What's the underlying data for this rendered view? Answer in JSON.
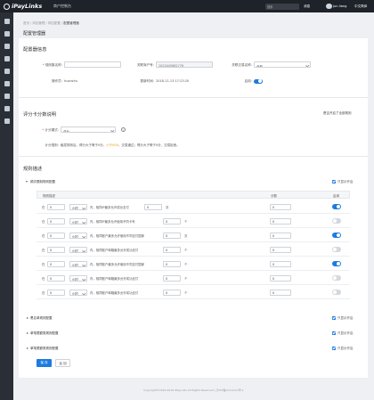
{
  "topbar": {
    "brand": "iPayLinks",
    "system_name": "商户控制台",
    "search_placeholder": "搜索",
    "notices": "消息",
    "user": "jun.liang",
    "help": "帮助",
    "lang": "中文简体"
  },
  "sidebar": {
    "icons": [
      "home-icon",
      "cart-icon",
      "list-icon",
      "card-icon",
      "document-icon",
      "user-icon",
      "shop-icon",
      "gear-icon",
      "shield-icon",
      "question-icon"
    ]
  },
  "breadcrumb": [
    "首页",
    "风控管理",
    "风控配置",
    "配置管理器"
  ],
  "page_title": "配置管理器",
  "config_info": {
    "title": "配置器信息",
    "rule_name_label": "规则集名称:",
    "rule_name_value": "",
    "merchant_no_label": "关联商户号:",
    "merchant_no_value": "1023445682776",
    "action_label": "关联交易名称:",
    "action_value": "全部",
    "operator_label": "操作员:",
    "operator_value": "huanzhu",
    "update_time_label": "更新时间:",
    "update_time_value": "2018-11-13 17:23:20",
    "enabled_label": "启用:",
    "enabled": true
  },
  "score_card": {
    "title": "评分卡分数说明",
    "link": "是否开启了全部规则",
    "calc_label": "计分模式:",
    "calc_value": "总分",
    "desc_label": "计分规则:",
    "desc_parts": [
      "触发规则后，得分大于等于0分，",
      "小于600",
      "，交易通过；得分大于等于0分，",
      "交易拒绝。"
    ]
  },
  "rules": {
    "title": "规则描述",
    "section1": {
      "label": "频次限制规则配置",
      "only_enabled": "只显示开启",
      "col_rule": "规则描述",
      "col_score": "分数",
      "col_enable": "启用",
      "rows": [
        {
          "prefix": "在",
          "v1": "0",
          "unit": "小时",
          "mid": "内，相同IP最多允许成功支付",
          "v2": "0",
          "suffix": "次",
          "score": "0",
          "enabled": true
        },
        {
          "prefix": "在",
          "v1": "0",
          "unit": "小时",
          "mid": "内，相同IP最多允许使用不同卡号",
          "v2": "0",
          "suffix": "个",
          "score": "0",
          "enabled": false
        },
        {
          "prefix": "在",
          "v1": "0",
          "unit": "小时",
          "mid": "内，相同账户最多允许使用不同支付国家",
          "v2": "0",
          "suffix": "次",
          "score": "0",
          "enabled": true
        },
        {
          "prefix": "在",
          "v1": "0",
          "unit": "小时",
          "mid": "内，相同账户邮箱最多允许成功支付",
          "v2": "0",
          "suffix": "个",
          "score": "0",
          "enabled": false
        },
        {
          "prefix": "在",
          "v1": "0",
          "unit": "小时",
          "mid": "内，相同账户最多允许使用不同支付国家",
          "v2": "0",
          "suffix": "个",
          "score": "0",
          "enabled": true
        },
        {
          "prefix": "在",
          "v1": "0",
          "unit": "小时",
          "mid": "内，相同账户邮箱最多允许成功支付",
          "v2": "0",
          "suffix": "个",
          "score": "0",
          "enabled": false
        },
        {
          "prefix": "在",
          "v1": "0",
          "unit": "小时",
          "mid": "内，相同账户邮箱最多允许成功支付",
          "v2": "0",
          "suffix": "个",
          "score": "0",
          "enabled": false
        }
      ]
    },
    "collapsed": [
      {
        "label": "黑名单规则配置",
        "only_enabled": "只显示开启"
      },
      {
        "label": "单笔限额类规则配置",
        "only_enabled": "只显示开启"
      },
      {
        "label": "单笔限额类规则配置",
        "only_enabled": "只显示开启"
      }
    ]
  },
  "actions": {
    "save": "保 存",
    "back": "返 回"
  },
  "footer": "Copyright©2016-2018 iPayLinks All Rights Reserved | 沪ICP备xxxxxxxx号-1",
  "colors": {
    "accent": "#1e7be0",
    "highlight": "#e8a317",
    "sidebar": "#2a2f37",
    "topbar": "#1e2229"
  }
}
